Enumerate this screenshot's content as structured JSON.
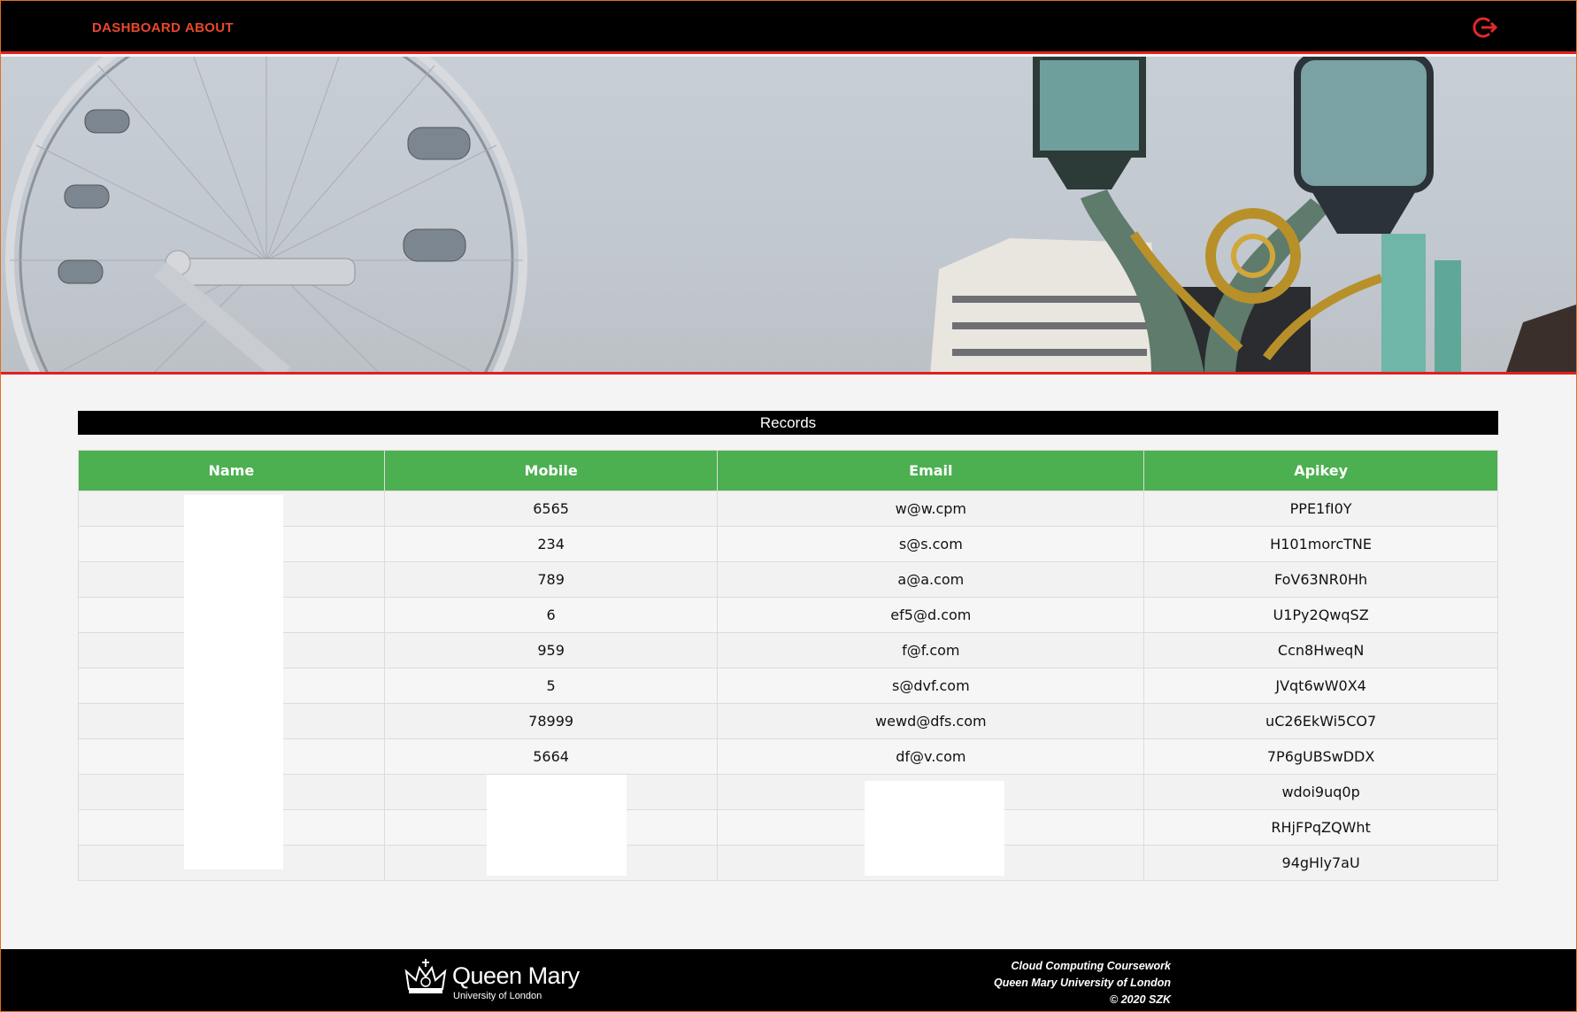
{
  "nav": {
    "dashboard_label": "DASHBOARD",
    "about_label": "ABOUT",
    "logout_icon": "logout-power-icon"
  },
  "colors": {
    "nav_bg": "#000000",
    "nav_link": "#e8482a",
    "accent_red": "#e02020",
    "table_header": "#4caf50",
    "page_bg": "#f4f4f4"
  },
  "records": {
    "title": "Records",
    "columns": [
      "Name",
      "Mobile",
      "Email",
      "Apikey"
    ],
    "rows": [
      {
        "name": "",
        "mobile": "6565",
        "email": "w@w.cpm",
        "apikey": "PPE1fI0Y"
      },
      {
        "name": "",
        "mobile": "234",
        "email": "s@s.com",
        "apikey": "H101morcTNE"
      },
      {
        "name": "",
        "mobile": "789",
        "email": "a@a.com",
        "apikey": "FoV63NR0Hh"
      },
      {
        "name": "",
        "mobile": "6",
        "email": "ef5@d.com",
        "apikey": "U1Py2QwqSZ"
      },
      {
        "name": "",
        "mobile": "959",
        "email": "f@f.com",
        "apikey": "Ccn8HweqN"
      },
      {
        "name": "",
        "mobile": "5",
        "email": "s@dvf.com",
        "apikey": "JVqt6wW0X4"
      },
      {
        "name": "",
        "mobile": "78999",
        "email": "wewd@dfs.com",
        "apikey": "uC26EkWi5CO7"
      },
      {
        "name": "",
        "mobile": "5664",
        "email": "df@v.com",
        "apikey": "7P6gUBSwDDX"
      },
      {
        "name": "",
        "mobile": "",
        "email": "",
        "apikey": "wdoi9uq0p"
      },
      {
        "name": "",
        "mobile": "",
        "email": "",
        "apikey": "RHjFPqZQWht"
      },
      {
        "name": "",
        "mobile": "",
        "email": "",
        "apikey": "94gHly7aU"
      }
    ]
  },
  "footer": {
    "logo_name": "Queen Mary",
    "logo_sub": "University of London",
    "line1": "Cloud Computing Coursework",
    "line2": "Queen Mary University of London",
    "line3": "© 2020 SZK"
  }
}
